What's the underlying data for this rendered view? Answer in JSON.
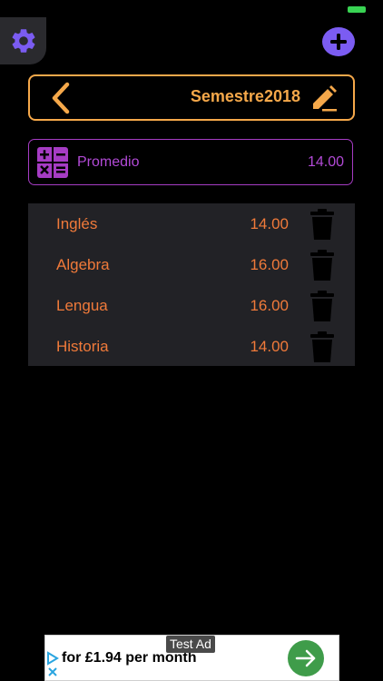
{
  "header": {
    "semester_title": "Semestre2018"
  },
  "average": {
    "label": "Promedio",
    "value": "14.00"
  },
  "subjects": [
    {
      "name": "Inglés",
      "grade": "14.00"
    },
    {
      "name": "Algebra",
      "grade": "16.00"
    },
    {
      "name": "Lengua",
      "grade": "16.00"
    },
    {
      "name": "Historia",
      "grade": "14.00"
    }
  ],
  "ad": {
    "tag": "Test Ad",
    "text": "for £1.94 per month"
  },
  "colors": {
    "accent_orange": "#f5a84a",
    "grade_orange": "#f07a3a",
    "average_purple": "#b24ad6",
    "add_button_purple": "#7b5cf2",
    "list_background": "#222226",
    "battery_green": "#39d353",
    "ad_go_green": "#3f9c4a"
  },
  "icons": {
    "settings": "gear-icon",
    "add": "plus-icon",
    "back": "chevron-left-icon",
    "edit": "pencil-icon",
    "calculator": "calculator-icon",
    "delete": "trash-icon",
    "ad_go": "arrow-right-icon",
    "ad_choices": "ad-choices-icon"
  }
}
